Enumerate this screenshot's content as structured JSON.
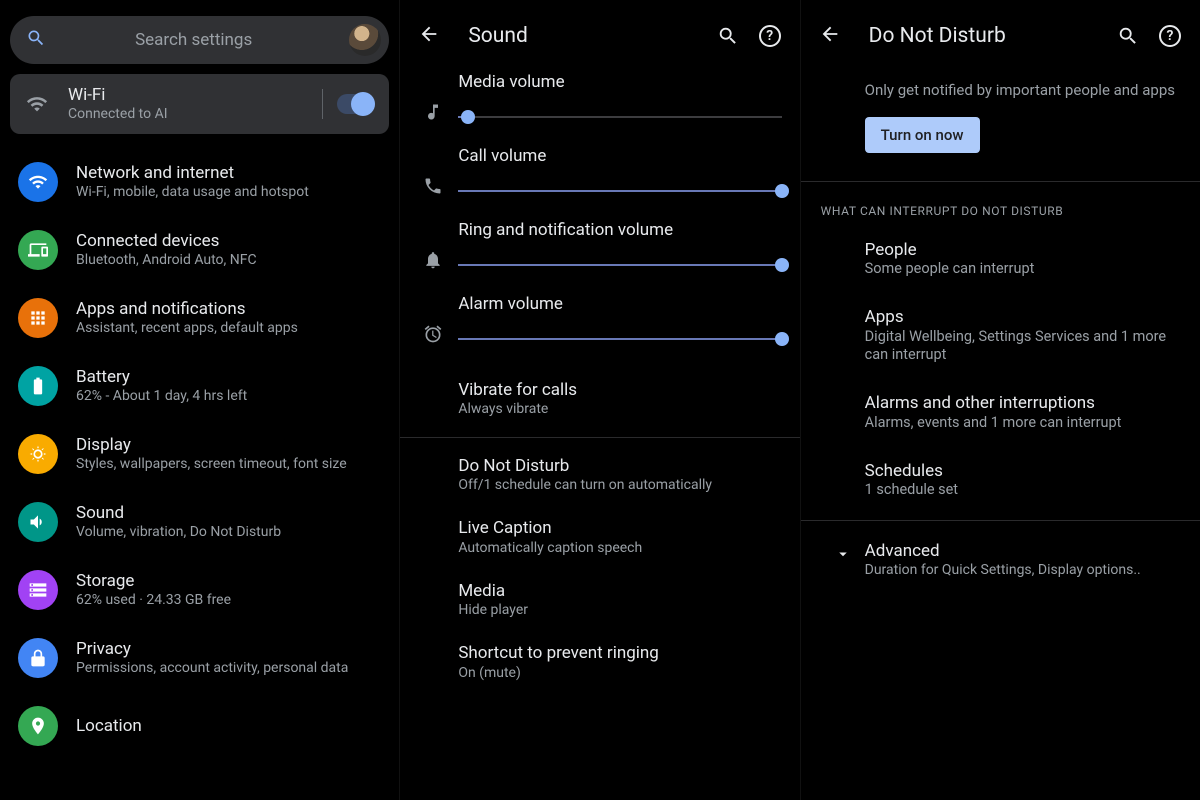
{
  "colors": {
    "accent": "#8ab4f8",
    "blue": "#1a73e8",
    "green": "#34a853",
    "orange": "#e8710a",
    "teal": "#00a3a3",
    "amber": "#f9ab00",
    "teal2": "#009688",
    "purple": "#a142f4",
    "lightblue": "#4285f4"
  },
  "screen1": {
    "search_placeholder": "Search settings",
    "wifi": {
      "title": "Wi-Fi",
      "subtitle": "Connected to AI",
      "toggle_on": true
    },
    "items": [
      {
        "icon": "wifi",
        "color": "#1a73e8",
        "title": "Network and internet",
        "subtitle": "Wi-Fi, mobile, data usage and hotspot"
      },
      {
        "icon": "devices",
        "color": "#34a853",
        "title": "Connected devices",
        "subtitle": "Bluetooth, Android Auto, NFC"
      },
      {
        "icon": "apps",
        "color": "#e8710a",
        "title": "Apps and notifications",
        "subtitle": "Assistant, recent apps, default apps"
      },
      {
        "icon": "battery",
        "color": "#00a3a3",
        "title": "Battery",
        "subtitle": "62% - About 1 day, 4 hrs left"
      },
      {
        "icon": "display",
        "color": "#f9ab00",
        "title": "Display",
        "subtitle": "Styles, wallpapers, screen timeout, font size"
      },
      {
        "icon": "sound",
        "color": "#009688",
        "title": "Sound",
        "subtitle": "Volume, vibration, Do Not Disturb"
      },
      {
        "icon": "storage",
        "color": "#a142f4",
        "title": "Storage",
        "subtitle": "62% used · 24.33 GB free"
      },
      {
        "icon": "privacy",
        "color": "#4285f4",
        "title": "Privacy",
        "subtitle": "Permissions, account activity, personal data"
      },
      {
        "icon": "location",
        "color": "#34a853",
        "title": "Location",
        "subtitle": ""
      }
    ]
  },
  "screen2": {
    "title": "Sound",
    "sliders": [
      {
        "icon": "music",
        "label": "Media volume",
        "value": 3
      },
      {
        "icon": "call",
        "label": "Call volume",
        "value": 100
      },
      {
        "icon": "bell",
        "label": "Ring and notification volume",
        "value": 100
      },
      {
        "icon": "alarm",
        "label": "Alarm volume",
        "value": 100
      }
    ],
    "vibrate": {
      "title": "Vibrate for calls",
      "subtitle": "Always vibrate"
    },
    "items": [
      {
        "title": "Do Not Disturb",
        "subtitle": "Off/1 schedule can turn on automatically"
      },
      {
        "title": "Live Caption",
        "subtitle": "Automatically caption speech"
      },
      {
        "title": "Media",
        "subtitle": "Hide player"
      },
      {
        "title": "Shortcut to prevent ringing",
        "subtitle": "On (mute)"
      }
    ]
  },
  "screen3": {
    "title": "Do Not Disturb",
    "intro": "Only get notified by important people and apps",
    "turn_on": "Turn on now",
    "section_header": "What can interrupt Do Not Disturb",
    "items": [
      {
        "title": "People",
        "subtitle": "Some people can interrupt"
      },
      {
        "title": "Apps",
        "subtitle": "Digital Wellbeing, Settings Services and 1 more can interrupt"
      },
      {
        "title": "Alarms and other interruptions",
        "subtitle": "Alarms, events and 1 more can interrupt"
      },
      {
        "title": "Schedules",
        "subtitle": "1 schedule set"
      }
    ],
    "advanced": {
      "title": "Advanced",
      "subtitle": "Duration for Quick Settings, Display options.."
    }
  }
}
